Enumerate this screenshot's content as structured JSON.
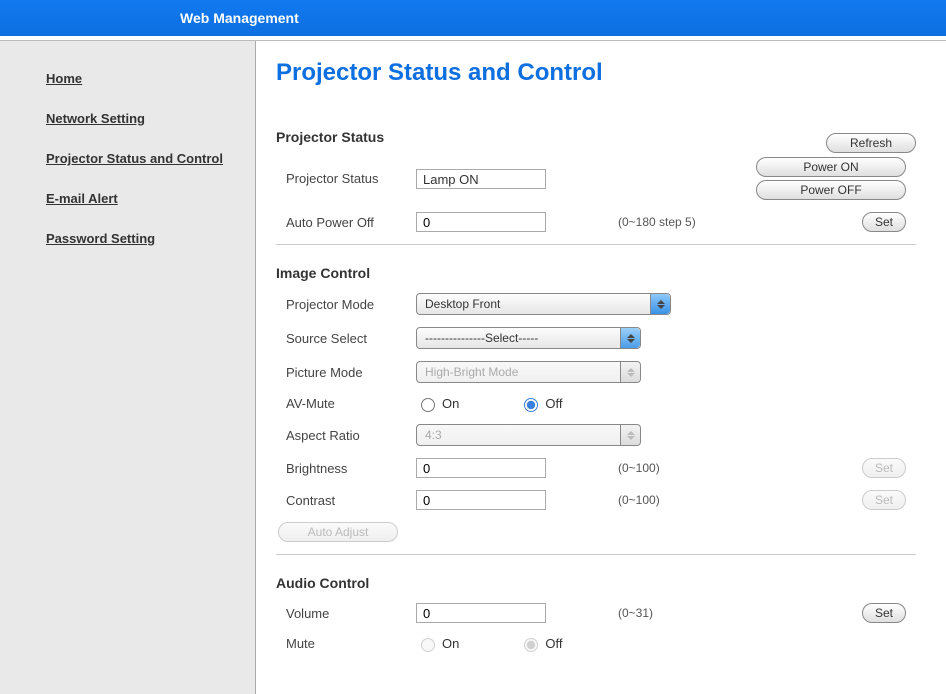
{
  "header": {
    "title": "Web Management"
  },
  "sidebar": {
    "items": [
      {
        "label": "Home"
      },
      {
        "label": "Network Setting"
      },
      {
        "label": "Projector Status and Control"
      },
      {
        "label": "E-mail Alert"
      },
      {
        "label": "Password Setting"
      }
    ]
  },
  "main": {
    "title": "Projector Status and Control",
    "buttons": {
      "refresh": "Refresh",
      "power_on": "Power ON",
      "power_off": "Power OFF",
      "set": "Set",
      "auto_adjust": "Auto Adjust"
    },
    "status": {
      "heading": "Projector Status",
      "projector_status_label": "Projector Status",
      "projector_status_value": "Lamp ON",
      "auto_power_off_label": "Auto Power Off",
      "auto_power_off_value": "0",
      "auto_power_off_hint": "(0~180 step 5)"
    },
    "image": {
      "heading": "Image Control",
      "projector_mode_label": "Projector Mode",
      "projector_mode_value": "Desktop Front",
      "source_select_label": "Source Select",
      "source_select_value": "---------------Select-----",
      "picture_mode_label": "Picture Mode",
      "picture_mode_value": "High-Bright Mode",
      "av_mute_label": "AV-Mute",
      "on_label": "On",
      "off_label": "Off",
      "aspect_ratio_label": "Aspect Ratio",
      "aspect_ratio_value": "4:3",
      "brightness_label": "Brightness",
      "brightness_value": "0",
      "brightness_hint": "(0~100)",
      "contrast_label": "Contrast",
      "contrast_value": "0",
      "contrast_hint": "(0~100)"
    },
    "audio": {
      "heading": "Audio Control",
      "volume_label": "Volume",
      "volume_value": "0",
      "volume_hint": "(0~31)",
      "mute_label": "Mute"
    }
  }
}
